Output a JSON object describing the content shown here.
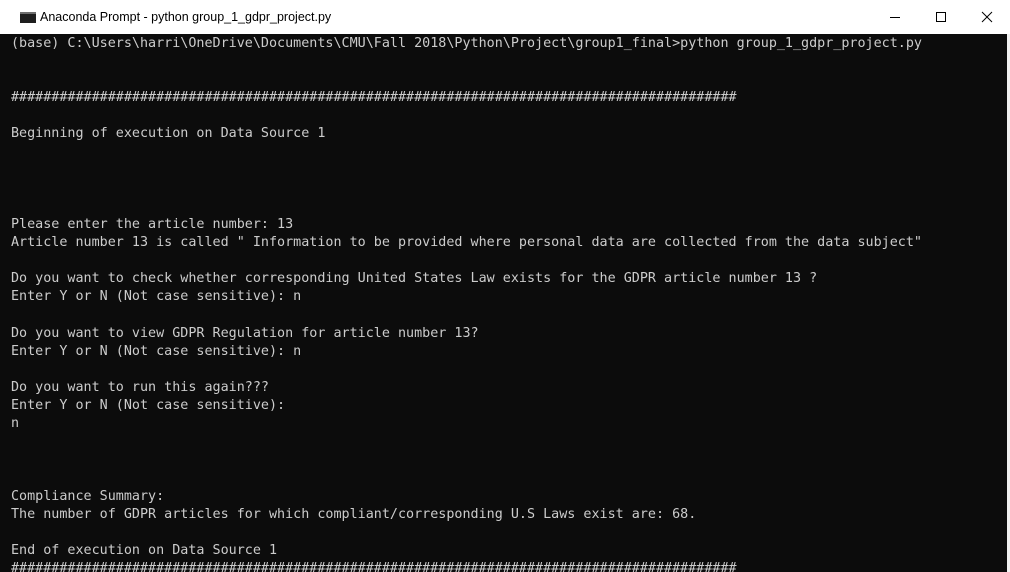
{
  "window": {
    "title": "Anaconda Prompt - python  group_1_gdpr_project.py"
  },
  "console": {
    "lines": [
      "(base) C:\\Users\\harri\\OneDrive\\Documents\\CMU\\Fall 2018\\Python\\Project\\group1_final>python group_1_gdpr_project.py",
      "##########################################################################################",
      "Beginning of execution on Data Source 1",
      "Please enter the article number: 13",
      "Article number 13 is called \" Information to be provided where personal data are collected from the data subject\"",
      "Do you want to check whether corresponding United States Law exists for the GDPR article number 13 ?",
      "Enter Y or N (Not case sensitive): n",
      "Do you want to view GDPR Regulation for article number 13?",
      "Enter Y or N (Not case sensitive): n",
      "Do you want to run this again???",
      "Enter Y or N (Not case sensitive):",
      "n",
      "Compliance Summary:",
      "The number of GDPR articles for which compliant/corresponding U.S Laws exist are: 68.",
      "End of execution on Data Source 1",
      "##########################################################################################"
    ]
  },
  "icons": {
    "app": "console-app-icon",
    "minimize": "minimize-icon",
    "maximize": "maximize-icon",
    "close": "close-icon"
  },
  "colors": {
    "console_background": "#0c0c0c",
    "console_text": "#cccccc",
    "titlebar_background": "#ffffff"
  }
}
